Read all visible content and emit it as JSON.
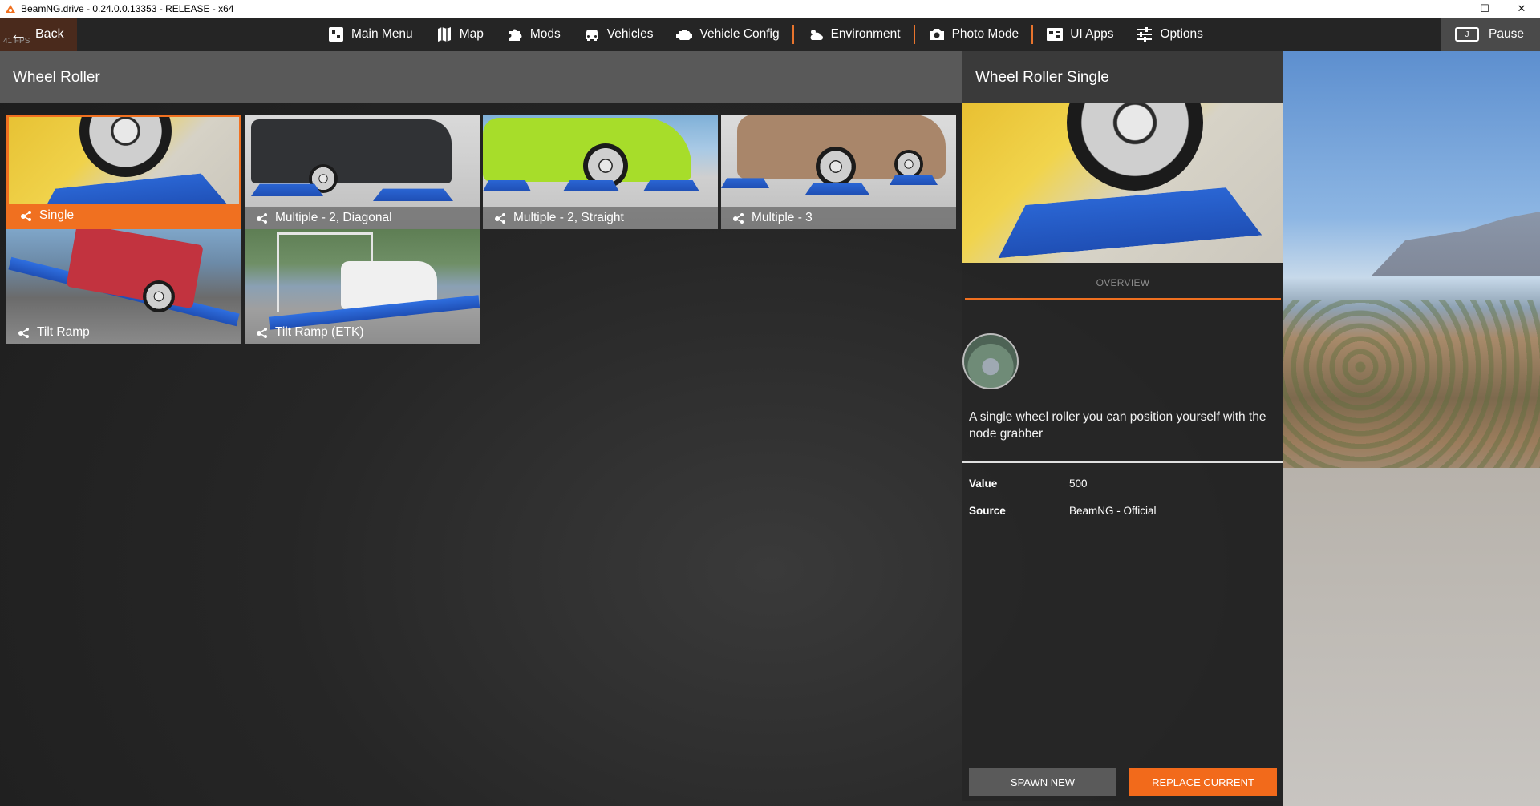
{
  "window": {
    "title": "BeamNG.drive - 0.24.0.0.13353 - RELEASE - x64",
    "minimize": "—",
    "maximize": "☐",
    "close": "✕"
  },
  "hud": {
    "fps": "41 FPS"
  },
  "menubar": {
    "back_label": "Back",
    "items": [
      {
        "label": "Main Menu",
        "icon": "main-menu-icon"
      },
      {
        "label": "Map",
        "icon": "map-icon"
      },
      {
        "label": "Mods",
        "icon": "puzzle-icon"
      },
      {
        "label": "Vehicles",
        "icon": "car-icon"
      },
      {
        "label": "Vehicle Config",
        "icon": "engine-icon"
      },
      {
        "label": "Environment",
        "icon": "weather-icon"
      },
      {
        "label": "Photo Mode",
        "icon": "camera-icon"
      },
      {
        "label": "UI Apps",
        "icon": "ui-apps-icon"
      },
      {
        "label": "Options",
        "icon": "sliders-icon"
      }
    ],
    "pause_label": "Pause",
    "pause_key": "J"
  },
  "panel": {
    "title": "Wheel Roller",
    "configs": [
      {
        "label": "Single",
        "selected": true
      },
      {
        "label": "Multiple - 2, Diagonal",
        "selected": false
      },
      {
        "label": "Multiple - 2, Straight",
        "selected": false
      },
      {
        "label": "Multiple - 3",
        "selected": false
      },
      {
        "label": "Tilt Ramp",
        "selected": false
      },
      {
        "label": "Tilt Ramp (ETK)",
        "selected": false
      }
    ]
  },
  "detail": {
    "title": "Wheel Roller Single",
    "tab_overview": "OVERVIEW",
    "description": "A single wheel roller you can position yourself with the node grabber",
    "info": [
      {
        "key": "Value",
        "value": "500"
      },
      {
        "key": "Source",
        "value": "BeamNG - Official"
      }
    ],
    "spawn_label": "SPAWN NEW",
    "replace_label": "REPLACE CURRENT"
  },
  "colors": {
    "accent": "#f07020",
    "panel_header": "#5e5e5e",
    "menubar": "#262626"
  }
}
